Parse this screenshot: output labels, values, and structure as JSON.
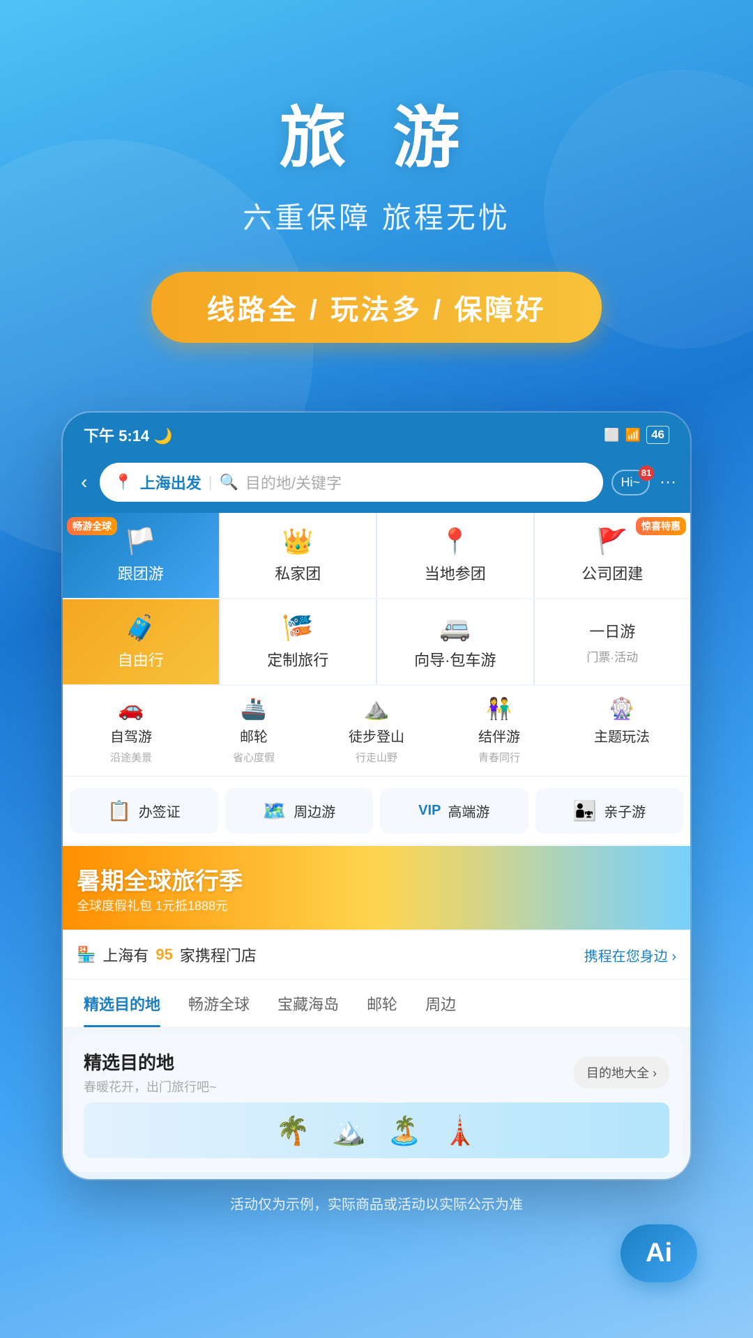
{
  "hero": {
    "title": "旅 游",
    "subtitle": "六重保障 旅程无忧",
    "badge": "线路全 / 玩法多 / 保障好"
  },
  "statusBar": {
    "time": "下午 5:14",
    "moonIcon": "🌙",
    "wifiIcon": "WiFi",
    "batteryLevel": "46"
  },
  "appHeader": {
    "backIcon": "‹",
    "locationLabel": "上海出发",
    "searchPlaceholder": "目的地/关键字",
    "hiBadge": "Hi~",
    "notifCount": "81",
    "moreIcon": "···"
  },
  "gridRow1": [
    {
      "label": "跟团游",
      "icon": "🏳️",
      "badge": "畅游全球",
      "badgePos": "topLeft"
    },
    {
      "label": "私家团",
      "icon": "👑",
      "badge": "",
      "badgePos": ""
    },
    {
      "label": "当地参团",
      "icon": "📍",
      "badge": "",
      "badgePos": ""
    },
    {
      "label": "公司团建",
      "icon": "🚩",
      "badge": "惊喜特惠",
      "badgePos": "topRight"
    }
  ],
  "gridRow2": [
    {
      "label": "自由行",
      "icon": "🧳",
      "badge": "",
      "badgePos": ""
    },
    {
      "label": "定制旅行",
      "icon": "🎏",
      "badge": "",
      "badgePos": ""
    },
    {
      "label": "向导·包车游",
      "icon": "💋",
      "badge": "",
      "badgePos": ""
    },
    {
      "label": "一日游",
      "sublabel": "门票·活动",
      "icon": "",
      "badge": "",
      "badgePos": ""
    }
  ],
  "smallIcons": [
    {
      "name": "自驾游",
      "sub": "沿途美景",
      "icon": "🚗"
    },
    {
      "name": "邮轮",
      "sub": "省心度假",
      "icon": "🚢"
    },
    {
      "name": "徒步登山",
      "sub": "行走山野",
      "icon": "⛰️"
    },
    {
      "name": "结伴游",
      "sub": "青春同行",
      "icon": "👫"
    },
    {
      "name": "主题玩法",
      "sub": "",
      "icon": "🎡"
    }
  ],
  "serviceTags": [
    {
      "label": "办签证",
      "icon": "📋"
    },
    {
      "label": "周边游",
      "icon": "🗺️"
    },
    {
      "label": "高端游",
      "icon": "💎"
    },
    {
      "label": "亲子游",
      "icon": "👨‍👧"
    }
  ],
  "banner": {
    "mainText": "暑期全球旅行季",
    "subText": "全球度假礼包 1元抵1888元"
  },
  "storeInfo": {
    "prefix": "上海有",
    "count": "95",
    "suffix": "家携程门店",
    "link": "携程在您身边 ›"
  },
  "tabs": [
    {
      "label": "精选目的地",
      "active": true
    },
    {
      "label": "畅游全球",
      "active": false
    },
    {
      "label": "宝藏海岛",
      "active": false
    },
    {
      "label": "邮轮",
      "active": false
    },
    {
      "label": "周边",
      "active": false
    }
  ],
  "destSection": {
    "title": "精选目的地",
    "subtitle": "春暖花开，出门旅行吧~",
    "linkLabel": "目的地大全 ›"
  },
  "disclaimer": "活动仅为示例，实际商品或活动以实际公示为准",
  "aiButton": "Ai"
}
